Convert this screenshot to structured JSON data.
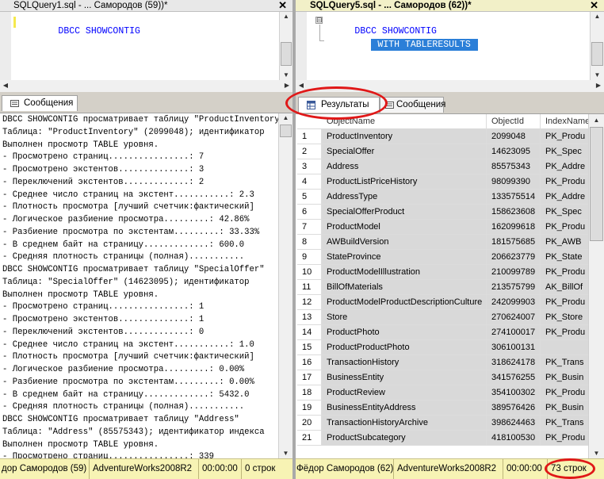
{
  "left": {
    "tab_title": "SQLQuery1.sql - ... Самородов (59))*",
    "close_glyph": "✕",
    "code_lines": [
      {
        "keyword": "DBCC SHOWCONTIG"
      }
    ],
    "messages_tab_label": "Сообщения",
    "messages": [
      "DBCC SHOWCONTIG просматривает таблицу \"ProductInventory\"",
      "Таблица: \"ProductInventory\" (2099048); идентификатор",
      "Выполнен просмотр TABLE уровня.",
      "- Просмотрено страниц................: 7",
      "- Просмотрено экстентов..............: 3",
      "- Переключений экстентов.............: 2",
      "- Среднее число страниц на экстент...........: 2.3",
      "- Плотность просмотра [лучший счетчик:фактический]",
      "- Логическое разбиение просмотра.........: 42.86%",
      "- Разбиение просмотра по экстентам.........: 33.33%",
      "- В среднем байт на страницу.............: 600.0",
      "- Средняя плотность страницы (полная)...........",
      "DBCC SHOWCONTIG просматривает таблицу \"SpecialOffer\"",
      "Таблица: \"SpecialOffer\" (14623095); идентификатор",
      "Выполнен просмотр TABLE уровня.",
      "- Просмотрено страниц................: 1",
      "- Просмотрено экстентов..............: 1",
      "- Переключений экстентов.............: 0",
      "- Среднее число страниц на экстент...........: 1.0",
      "- Плотность просмотра [лучший счетчик:фактический]",
      "- Логическое разбиение просмотра.........: 0.00%",
      "- Разбиение просмотра по экстентам.........: 0.00%",
      "- В среднем байт на страницу.............: 5432.0",
      "- Средняя плотность страницы (полная)...........",
      "DBCC SHOWCONTIG просматривает таблицу \"Address\"",
      "Таблица: \"Address\" (85575343); идентификатор индекса",
      "Выполнен просмотр TABLE уровня.",
      "- Просмотрено страниц................: 339"
    ],
    "status": [
      "дор Самородов (59)",
      "AdventureWorks2008R2",
      "00:00:00",
      "0 строк"
    ]
  },
  "right": {
    "tab_title": "SQLQuery5.sql - ... Самородов (62))*",
    "close_glyph": "✕",
    "outline_glyph": "⊟",
    "code_lines": [
      {
        "keyword": "DBCC SHOWCONTIG"
      },
      {
        "keyword": "WITH TABLERESULTS"
      }
    ],
    "results_tab_label": "Результаты",
    "messages_tab_label": "Сообщения",
    "columns": [
      "ObjectName",
      "ObjectId",
      "IndexName"
    ],
    "rows": [
      {
        "n": "1",
        "name": "ProductInventory",
        "id": "2099048",
        "index": "PK_Produ"
      },
      {
        "n": "2",
        "name": "SpecialOffer",
        "id": "14623095",
        "index": "PK_Spec"
      },
      {
        "n": "3",
        "name": "Address",
        "id": "85575343",
        "index": "PK_Addre"
      },
      {
        "n": "4",
        "name": "ProductListPriceHistory",
        "id": "98099390",
        "index": "PK_Produ"
      },
      {
        "n": "5",
        "name": "AddressType",
        "id": "133575514",
        "index": "PK_Addre"
      },
      {
        "n": "6",
        "name": "SpecialOfferProduct",
        "id": "158623608",
        "index": "PK_Spec"
      },
      {
        "n": "7",
        "name": "ProductModel",
        "id": "162099618",
        "index": "PK_Produ"
      },
      {
        "n": "8",
        "name": "AWBuildVersion",
        "id": "181575685",
        "index": "PK_AWB"
      },
      {
        "n": "9",
        "name": "StateProvince",
        "id": "206623779",
        "index": "PK_State"
      },
      {
        "n": "10",
        "name": "ProductModelIllustration",
        "id": "210099789",
        "index": "PK_Produ"
      },
      {
        "n": "11",
        "name": "BillOfMaterials",
        "id": "213575799",
        "index": "AK_BillOf"
      },
      {
        "n": "12",
        "name": "ProductModelProductDescriptionCulture",
        "id": "242099903",
        "index": "PK_Produ"
      },
      {
        "n": "13",
        "name": "Store",
        "id": "270624007",
        "index": "PK_Store"
      },
      {
        "n": "14",
        "name": "ProductPhoto",
        "id": "274100017",
        "index": "PK_Produ"
      },
      {
        "n": "15",
        "name": "ProductProductPhoto",
        "id": "306100131",
        "index": ""
      },
      {
        "n": "16",
        "name": "TransactionHistory",
        "id": "318624178",
        "index": "PK_Trans"
      },
      {
        "n": "17",
        "name": "BusinessEntity",
        "id": "341576255",
        "index": "PK_Busin"
      },
      {
        "n": "18",
        "name": "ProductReview",
        "id": "354100302",
        "index": "PK_Produ"
      },
      {
        "n": "19",
        "name": "BusinessEntityAddress",
        "id": "389576426",
        "index": "PK_Busin"
      },
      {
        "n": "20",
        "name": "TransactionHistoryArchive",
        "id": "398624463",
        "index": "PK_Trans"
      },
      {
        "n": "21",
        "name": "ProductSubcategory",
        "id": "418100530",
        "index": "PK_Produ"
      }
    ],
    "status": [
      "Фёдор Самородов (62)",
      "AdventureWorks2008R2",
      "00:00:00",
      "73 строк"
    ]
  },
  "colors": {
    "status_bg": "#f7f3b4",
    "highlight_red": "#e01818",
    "keyword_blue": "#0000ff",
    "selection": "#2b7fd8"
  }
}
